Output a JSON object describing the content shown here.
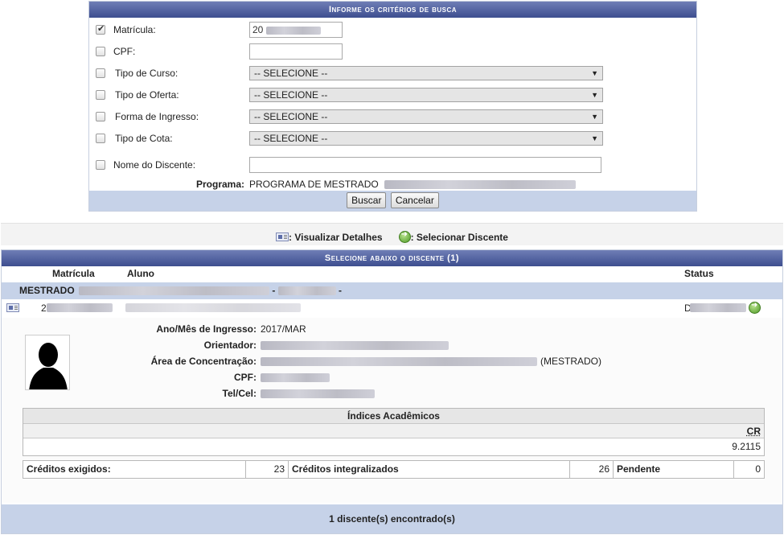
{
  "search": {
    "caption": "Informe os critérios de busca",
    "fields": {
      "matricula": {
        "label": "Matrícula:",
        "value": "20",
        "checked": true
      },
      "cpf": {
        "label": "CPF:",
        "value": ""
      },
      "tipo_curso": {
        "label": "Tipo de Curso:",
        "selected": "-- SELECIONE --"
      },
      "tipo_oferta": {
        "label": "Tipo de Oferta:",
        "selected": "-- SELECIONE --"
      },
      "forma_ingresso": {
        "label": "Forma de Ingresso:",
        "selected": "-- SELECIONE --"
      },
      "tipo_cota": {
        "label": "Tipo de Cota:",
        "selected": "-- SELECIONE --"
      },
      "nome_discente": {
        "label": "Nome do Discente:",
        "value": ""
      }
    },
    "programa": {
      "label": "Programa:",
      "value": "PROGRAMA DE MESTRADO"
    },
    "buttons": {
      "buscar": "Buscar",
      "cancelar": "Cancelar"
    }
  },
  "legend": {
    "details": ": Visualizar Detalhes",
    "select": ": Selecionar Discente"
  },
  "results": {
    "caption": "Selecione abaixo o discente (1)",
    "columns": {
      "matricula": "Matrícula",
      "aluno": "Aluno",
      "status": "Status"
    },
    "group": {
      "name": "MESTRADO",
      "sep1": "-",
      "sep2": "-"
    },
    "student": {
      "matricula_prefix": "2",
      "status_prefix": "D",
      "details": {
        "ano_mes_label": "Ano/Mês de Ingresso:",
        "ano_mes_value": "2017/MAR",
        "orientador_label": "Orientador:",
        "area_label": "Área de Concentração:",
        "area_suffix": "(MESTRADO)",
        "cpf_label": "CPF:",
        "tel_label": "Tel/Cel:"
      },
      "indices": {
        "title": "Índices Acadêmicos",
        "cr_label": "CR",
        "cr_value": "9.2115"
      },
      "creditos": {
        "exigidos_label": "Créditos exigidos:",
        "exigidos_value": "23",
        "integralizados_label": "Créditos integralizados",
        "integralizados_value": "26",
        "pendente_label": "Pendente",
        "pendente_value": "0"
      }
    },
    "footer": "1 discente(s) encontrado(s)"
  },
  "icons": {
    "details": "student-card-icon",
    "select": "green-arrow-icon"
  },
  "colors": {
    "caption_bar": "#3d4e8f",
    "highlight_row": "#c6d2e8"
  }
}
